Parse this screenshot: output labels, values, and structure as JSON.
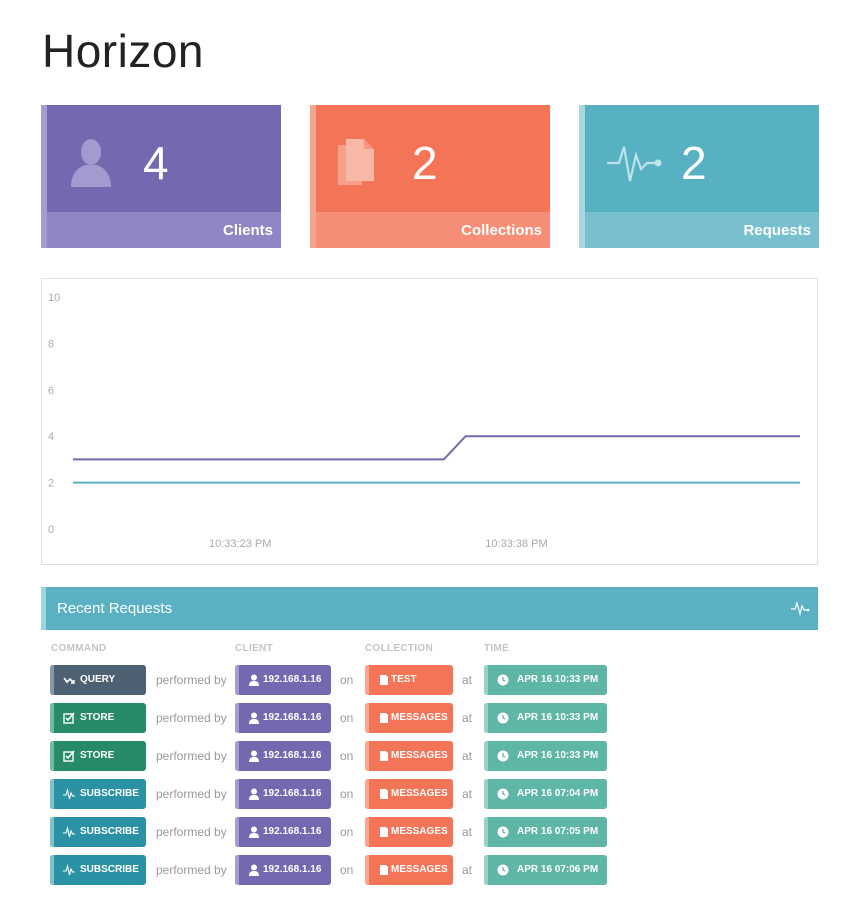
{
  "app": {
    "title": "Horizon"
  },
  "stats": [
    {
      "value": "4",
      "label": "Clients",
      "icon": "user-icon"
    },
    {
      "value": "2",
      "label": "Collections",
      "icon": "documents-icon"
    },
    {
      "value": "2",
      "label": "Requests",
      "icon": "pulse-icon"
    }
  ],
  "chart_data": {
    "type": "line",
    "title": "",
    "xlabel": "",
    "ylabel": "",
    "ylim": [
      0,
      10
    ],
    "yticks": [
      "10",
      "8",
      "6",
      "4",
      "2",
      "0"
    ],
    "xticks": [
      "10:33:23 PM",
      "10:33:38 PM"
    ],
    "grid": false,
    "series": [
      {
        "color": "#7468b0",
        "points": [
          [
            0,
            3
          ],
          [
            0.51,
            3
          ],
          [
            0.54,
            4
          ],
          [
            1,
            4
          ]
        ]
      },
      {
        "color": "#58b1c3",
        "points": [
          [
            0,
            2
          ],
          [
            1,
            2
          ]
        ]
      }
    ]
  },
  "recent": {
    "title": "Recent Requests",
    "icon": "pulse-icon",
    "headers": {
      "command": "COMMAND",
      "client": "CLIENT",
      "collection": "COLLECTION",
      "time": "TIME"
    },
    "connectors": {
      "performed": "performed by",
      "on": "on",
      "at": "at"
    },
    "rows": [
      {
        "command": "QUERY",
        "cmd_type": "q",
        "cmd_icon": "query-icon",
        "client": "192.168.1.16",
        "collection": "TEST",
        "time": "APR 16 10:33 PM"
      },
      {
        "command": "STORE",
        "cmd_type": "s",
        "cmd_icon": "store-icon",
        "client": "192.168.1.16",
        "collection": "MESSAGES",
        "time": "APR 16 10:33 PM"
      },
      {
        "command": "STORE",
        "cmd_type": "s",
        "cmd_icon": "store-icon",
        "client": "192.168.1.16",
        "collection": "MESSAGES",
        "time": "APR 16 10:33 PM"
      },
      {
        "command": "SUBSCRIBE",
        "cmd_type": "u",
        "cmd_icon": "subscribe-icon",
        "client": "192.168.1.16",
        "collection": "MESSAGES",
        "time": "APR 16 07:04 PM"
      },
      {
        "command": "SUBSCRIBE",
        "cmd_type": "u",
        "cmd_icon": "subscribe-icon",
        "client": "192.168.1.16",
        "collection": "MESSAGES",
        "time": "APR 16 07:05 PM"
      },
      {
        "command": "SUBSCRIBE",
        "cmd_type": "u",
        "cmd_icon": "subscribe-icon",
        "client": "192.168.1.16",
        "collection": "MESSAGES",
        "time": "APR 16 07:06 PM"
      }
    ]
  }
}
